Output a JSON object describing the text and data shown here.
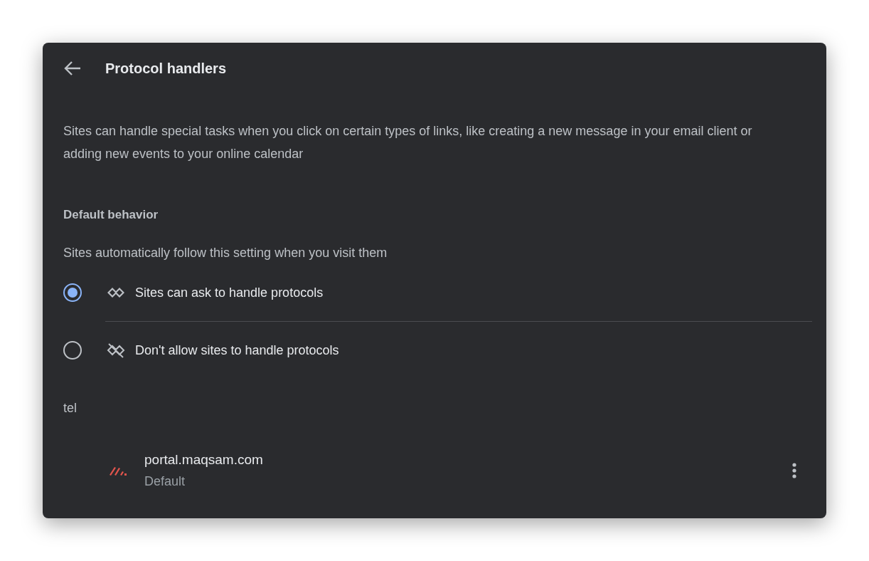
{
  "header": {
    "title": "Protocol handlers"
  },
  "description": "Sites can handle special tasks when you click on certain types of links, like creating a new message in your email client or adding new events to your online calendar",
  "default_behavior": {
    "heading": "Default behavior",
    "subtitle": "Sites automatically follow this setting when you visit them",
    "options": [
      {
        "kind": "allow",
        "label": "Sites can ask to handle protocols",
        "selected": true
      },
      {
        "kind": "block",
        "label": "Don't allow sites to handle protocols",
        "selected": false
      }
    ]
  },
  "protocols": [
    {
      "name": "tel",
      "sites": [
        {
          "host": "portal.maqsam.com",
          "status": "Default"
        }
      ]
    }
  ]
}
